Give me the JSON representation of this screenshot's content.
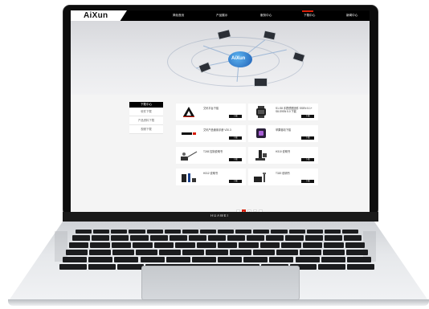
{
  "site": {
    "logo": "AiXun",
    "nav": [
      {
        "label": "简化首页"
      },
      {
        "label": "产品展示"
      },
      {
        "label": "服务中心"
      },
      {
        "label": "下载中心",
        "active": true
      },
      {
        "label": "新闻中心"
      }
    ],
    "accent_color": "#d81e06"
  },
  "banner": {
    "cloud_label": "AiXun"
  },
  "sidebar": {
    "title": "下载中心",
    "items": [
      {
        "label": "软件下载"
      },
      {
        "label": "产品资料下载"
      },
      {
        "label": "视频下载"
      }
    ]
  },
  "downloads": [
    {
      "title": "艾讯平台下载",
      "button": "下载",
      "thumb": "aixun-logo-a"
    },
    {
      "title": "S1-S8 手表镜框固件 SSEN 5.1+ S8-S9SN 5.0 下载",
      "button": "下载",
      "thumb": "watch"
    },
    {
      "title": "艾讯产品使用手册 V20.3",
      "button": "下载",
      "thumb": "aixun-logo-text"
    },
    {
      "title": "苹果驱动下载",
      "button": "下载",
      "thumb": "purple-app"
    },
    {
      "title": "T245 控制说明书",
      "button": "下载",
      "thumb": "soldering-station-1"
    },
    {
      "title": "H310 说明书",
      "button": "下载",
      "thumb": "hot-air-station"
    },
    {
      "title": "H312 说明书",
      "button": "下载",
      "thumb": "soldering-station-2"
    },
    {
      "title": "T320 说明书",
      "button": "下载",
      "thumb": "soldering-station-3"
    }
  ],
  "pagination": {
    "prev": "‹",
    "pages": [
      "1",
      "2",
      "3"
    ],
    "active": "1",
    "next": "›"
  },
  "laptop": {
    "brand": "HUAWEI"
  }
}
